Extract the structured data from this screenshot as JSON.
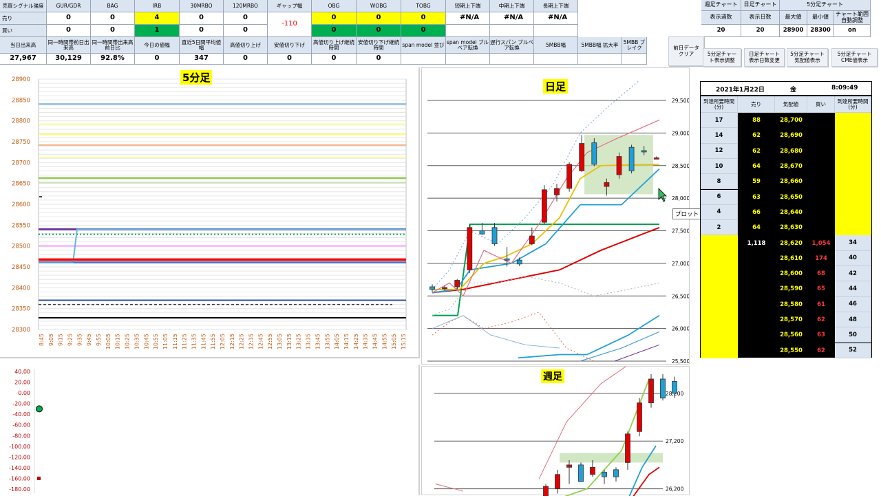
{
  "signal_table": {
    "row_labels": {
      "corner": "売買シグナル強度",
      "sell": "売り",
      "buy": "買い"
    },
    "columns": [
      {
        "header": "GUR/GDR",
        "sell": "0",
        "buy": "0",
        "sell_color": "white",
        "buy_color": "white"
      },
      {
        "header": "BAG",
        "sell": "0",
        "buy": "0",
        "sell_color": "white",
        "buy_color": "white"
      },
      {
        "header": "IRB",
        "sell": "4",
        "buy": "1",
        "sell_color": "yellow",
        "buy_color": "green"
      },
      {
        "header": "30MRBO",
        "sell": "0",
        "buy": "0",
        "sell_color": "white",
        "buy_color": "white"
      },
      {
        "header": "120MRBO",
        "sell": "0",
        "buy": "0",
        "sell_color": "white",
        "buy_color": "white"
      },
      {
        "header": "ギャップ幅",
        "sell": "-110",
        "buy": "",
        "sell_color": "white",
        "buy_color": "white"
      },
      {
        "header": "OBG",
        "sell": "0",
        "buy": "0",
        "sell_color": "yellow",
        "buy_color": "green"
      },
      {
        "header": "WOBG",
        "sell": "0",
        "buy": "0",
        "sell_color": "yellow",
        "buy_color": "green"
      },
      {
        "header": "TOBG",
        "sell": "0",
        "buy": "0",
        "sell_color": "yellow",
        "buy_color": "green"
      },
      {
        "header": "短期上下端",
        "sell": "#N/A",
        "buy": "",
        "sell_color": "white",
        "buy_color": "white"
      },
      {
        "header": "中期上下端",
        "sell": "#N/A",
        "buy": "",
        "sell_color": "white",
        "buy_color": "white"
      },
      {
        "header": "長期上下端",
        "sell": "#N/A",
        "buy": "",
        "sell_color": "white",
        "buy_color": "white"
      }
    ],
    "row3": [
      {
        "header": "当日出来高",
        "value": "27,967"
      },
      {
        "header": "同一時間帯前日出来高",
        "value": "30,129"
      },
      {
        "header": "同一時間帯出来高前日比",
        "value": "92.8%"
      },
      {
        "header": "今日の値幅",
        "value": "0"
      },
      {
        "header": "直近5日間平均値幅",
        "value": "347"
      },
      {
        "header": "高値切り上げ",
        "value": "0"
      },
      {
        "header": "安値切り下げ",
        "value": "0"
      },
      {
        "header": "高値切り上げ継続時間",
        "value": "0"
      },
      {
        "header": "安値切り下げ継続時間",
        "value": "0"
      },
      {
        "header": "span model 並び",
        "value": ""
      },
      {
        "header": "span model ブルベア転換",
        "value": ""
      },
      {
        "header": "遅行スパン ブルベア転換",
        "value": ""
      },
      {
        "header": "5MBB幅",
        "value": ""
      },
      {
        "header": "5MBB幅 拡大率",
        "value": ""
      },
      {
        "header": "5MBB ブレイク",
        "value": ""
      }
    ]
  },
  "chart_settings": {
    "headers": {
      "weekly": "週足チャート",
      "daily": "日足チャート",
      "five_min": "5分足チャート"
    },
    "subheaders": [
      "表示週数",
      "表示日数",
      "最大値",
      "最小値",
      "チャート範囲自動調整"
    ],
    "values": [
      "20",
      "20",
      "28900",
      "28300",
      "on"
    ]
  },
  "buttons": {
    "daily_data_clear": "前日データクリア",
    "five_min_adjust": "5分足チャート表示調整",
    "daily_days_change": "日足チャート表示日数変更",
    "five_min_quote": "5分足チャート気配値表示",
    "five_min_cme": "5分足チャートCME値表示"
  },
  "charts": {
    "five_min_title": "5分足",
    "daily_title": "日足",
    "weekly_title": "週足",
    "tooltip": "プロット エリア"
  },
  "five_min_chart": {
    "yticks": [
      "28900",
      "28850",
      "28800",
      "28750",
      "28700",
      "28650",
      "28600",
      "28550",
      "28500",
      "28450",
      "28400",
      "28350",
      "28300"
    ],
    "xticks": [
      "8:45",
      "9:05",
      "9:15",
      "9:25",
      "9:35",
      "9:45",
      "9:55",
      "10:05",
      "10:15",
      "10:25",
      "10:35",
      "10:45",
      "10:55",
      "11:05",
      "11:15",
      "11:25",
      "11:35",
      "11:45",
      "11:55",
      "12:05",
      "12:15",
      "12:25",
      "12:35",
      "12:45",
      "12:55",
      "13:05",
      "13:15",
      "13:25",
      "13:35",
      "13:45",
      "13:55",
      "14:05",
      "14:15",
      "14:25",
      "14:35",
      "14:45",
      "14:55",
      "15:05",
      "15:15"
    ],
    "ylim": [
      28300,
      28900
    ],
    "levels": [
      {
        "y": 28840,
        "color": "#9dc3e6"
      },
      {
        "y": 28792,
        "color": "#ffff99"
      },
      {
        "y": 28768,
        "color": "#ffff66"
      },
      {
        "y": 28742,
        "color": "#f4b183"
      },
      {
        "y": 28712,
        "color": "#ffff99"
      },
      {
        "y": 28663,
        "color": "#92d050"
      },
      {
        "y": 28652,
        "color": "#c5e0b4"
      },
      {
        "y": 28540,
        "color": "#7030a0"
      },
      {
        "y": 28500,
        "color": "#ff99ff"
      },
      {
        "y": 28467,
        "color": "#ff0000"
      },
      {
        "y": 28460,
        "color": "#4472c4"
      },
      {
        "y": 28370,
        "color": "#2f5597"
      },
      {
        "y": 28328,
        "color": "#000000"
      }
    ]
  },
  "oscillator": {
    "yticks": [
      "40.00",
      "20.00",
      "0.00",
      "-20.00",
      "-40.00",
      "-60.00",
      "-80.00",
      "-100.00",
      "-120.00",
      "-140.00",
      "-160.00",
      "-180.00"
    ],
    "ylim": [
      -180,
      40
    ],
    "points": [
      {
        "y": -30,
        "color": "#00b050"
      },
      {
        "y": -160,
        "color": "#c00000"
      }
    ]
  },
  "daily_chart": {
    "yticks": [
      "29,500",
      "29,000",
      "28,500",
      "28,000",
      "27,500",
      "27,000",
      "26,500",
      "26,000",
      "25,500"
    ],
    "ylim": [
      25500,
      29500
    ],
    "candles": [
      {
        "o": 26640,
        "h": 26680,
        "l": 26560,
        "c": 26600
      },
      {
        "o": 26620,
        "h": 26660,
        "l": 26580,
        "c": 26630
      },
      {
        "o": 26640,
        "h": 26760,
        "l": 26600,
        "c": 26740
      },
      {
        "o": 26900,
        "h": 27600,
        "l": 26850,
        "c": 27550
      },
      {
        "o": 27500,
        "h": 27620,
        "l": 27440,
        "c": 27450
      },
      {
        "o": 27550,
        "h": 27620,
        "l": 27270,
        "c": 27300
      },
      {
        "o": 27070,
        "h": 27250,
        "l": 26950,
        "c": 27060
      },
      {
        "o": 27050,
        "h": 27090,
        "l": 26960,
        "c": 26990
      },
      {
        "o": 27300,
        "h": 27550,
        "l": 27280,
        "c": 27420
      },
      {
        "o": 27630,
        "h": 28200,
        "l": 27600,
        "c": 28130
      },
      {
        "o": 28050,
        "h": 28220,
        "l": 27950,
        "c": 28150
      },
      {
        "o": 28150,
        "h": 28550,
        "l": 28100,
        "c": 28520
      },
      {
        "o": 28420,
        "h": 28970,
        "l": 28400,
        "c": 28840
      },
      {
        "o": 28850,
        "h": 28920,
        "l": 28490,
        "c": 28520
      },
      {
        "o": 28180,
        "h": 28300,
        "l": 28040,
        "c": 28240
      },
      {
        "o": 28360,
        "h": 28700,
        "l": 28300,
        "c": 28640
      },
      {
        "o": 28780,
        "h": 28820,
        "l": 28380,
        "c": 28420
      },
      {
        "o": 28730,
        "h": 28800,
        "l": 28660,
        "c": 28720
      },
      {
        "o": 28620,
        "h": 28640,
        "l": 28600,
        "c": 28620
      }
    ]
  },
  "weekly_chart": {
    "yticks": [
      "28,200",
      "27,200",
      "26,200"
    ],
    "ylim": [
      26050,
      28500
    ],
    "candles": [
      {
        "o": 26000,
        "h": 26300,
        "l": 25900,
        "c": 26250
      },
      {
        "o": 26200,
        "h": 26600,
        "l": 26100,
        "c": 26500
      },
      {
        "o": 26650,
        "h": 26800,
        "l": 26300,
        "c": 26700
      },
      {
        "o": 26700,
        "h": 26750,
        "l": 26400,
        "c": 26350
      },
      {
        "o": 26500,
        "h": 26800,
        "l": 26450,
        "c": 26650
      },
      {
        "o": 26550,
        "h": 26600,
        "l": 26300,
        "c": 26450
      },
      {
        "o": 26600,
        "h": 26650,
        "l": 26350,
        "c": 26450
      },
      {
        "o": 26750,
        "h": 27400,
        "l": 26600,
        "c": 27350
      },
      {
        "o": 27400,
        "h": 28100,
        "l": 27300,
        "c": 28000
      },
      {
        "o": 28000,
        "h": 28600,
        "l": 27900,
        "c": 28500
      },
      {
        "o": 28500,
        "h": 28600,
        "l": 28050,
        "c": 28100
      },
      {
        "o": 28450,
        "h": 28550,
        "l": 28100,
        "c": 28200
      }
    ]
  },
  "board": {
    "date": "2021年1月22日",
    "weekday": "金",
    "time": "8:09:49",
    "headers": [
      "到達所要時間 (分)",
      "売り",
      "気配値",
      "買い",
      "到達所要時間 (分)"
    ],
    "asks": [
      {
        "time": "17",
        "qty": "88",
        "price": "28,700"
      },
      {
        "time": "14",
        "qty": "62",
        "price": "28,690"
      },
      {
        "time": "12",
        "qty": "62",
        "price": "28,680"
      },
      {
        "time": "10",
        "qty": "64",
        "price": "28,670"
      },
      {
        "time": "8",
        "qty": "59",
        "price": "28,660"
      },
      {
        "time": "6",
        "qty": "63",
        "price": "28,650"
      },
      {
        "time": "4",
        "qty": "66",
        "price": "28,640"
      },
      {
        "time": "2",
        "qty": "64",
        "price": "28,630"
      }
    ],
    "bids": [
      {
        "sell_total": "1,118",
        "price": "28,620",
        "qty": "1,054",
        "time": "34"
      },
      {
        "sell_total": "",
        "price": "28,610",
        "qty": "174",
        "time": "40"
      },
      {
        "sell_total": "",
        "price": "28,600",
        "qty": "68",
        "time": "42"
      },
      {
        "sell_total": "",
        "price": "28,590",
        "qty": "65",
        "time": "44"
      },
      {
        "sell_total": "",
        "price": "28,580",
        "qty": "61",
        "time": "46"
      },
      {
        "sell_total": "",
        "price": "28,570",
        "qty": "62",
        "time": "48"
      },
      {
        "sell_total": "",
        "price": "28,560",
        "qty": "63",
        "time": "50"
      },
      {
        "sell_total": "",
        "price": "28,550",
        "qty": "62",
        "time": "52"
      }
    ]
  }
}
